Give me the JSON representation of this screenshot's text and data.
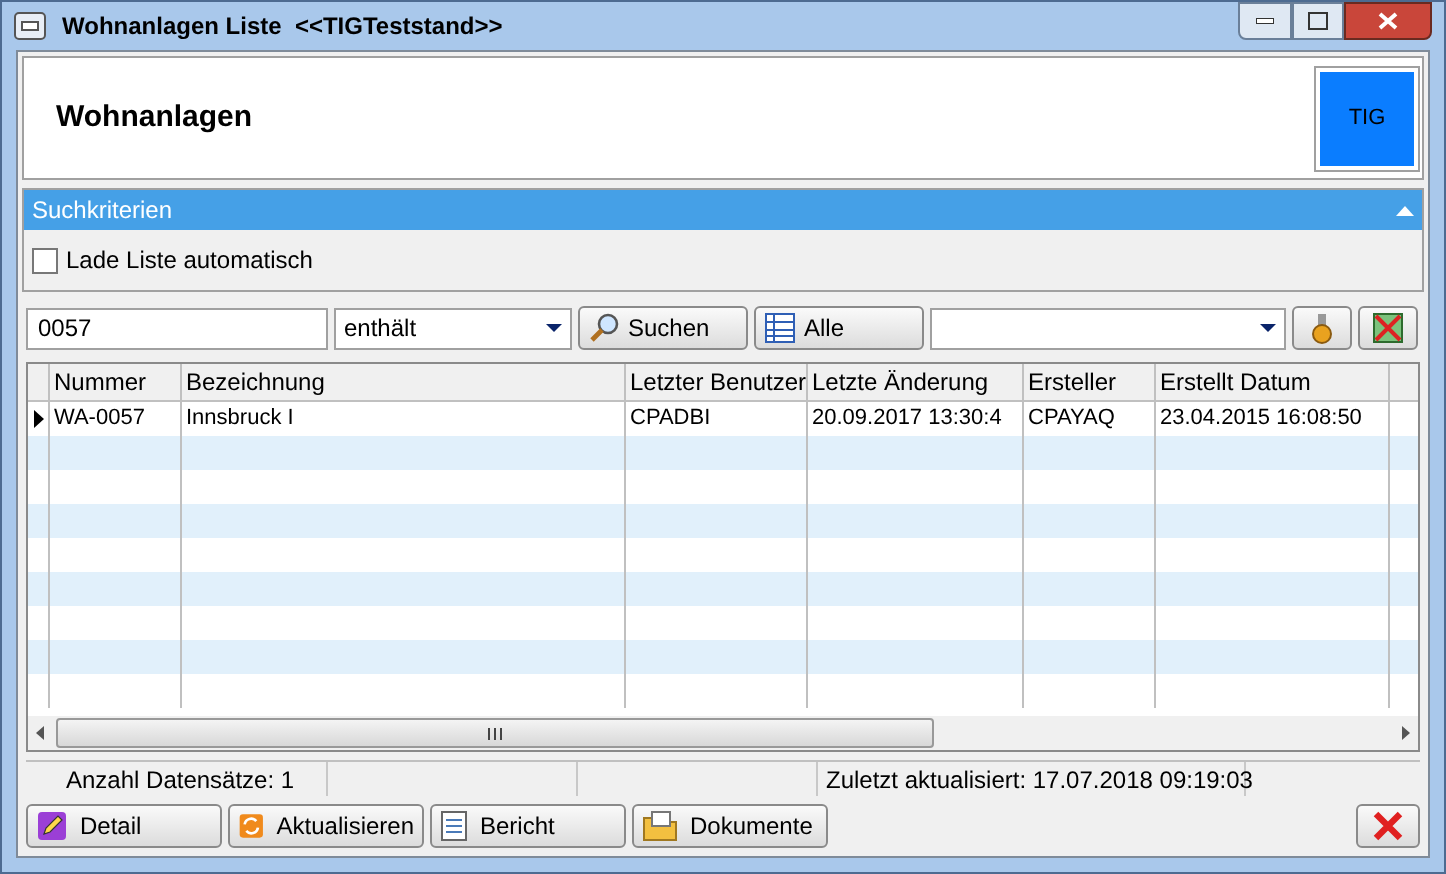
{
  "window": {
    "title": "Wohnanlagen Liste  <<TIGTeststand>>"
  },
  "header": {
    "title": "Wohnanlagen",
    "logo": "TIG"
  },
  "search_panel": {
    "title": "Suchkriterien",
    "expanded": true,
    "auto_load": {
      "label": "Lade Liste automatisch",
      "checked": false
    }
  },
  "filter": {
    "value": "0057",
    "operator": "enthält",
    "search_button": "Suchen",
    "all_button": "Alle"
  },
  "table": {
    "columns": [
      "Nummer",
      "Bezeichnung",
      "Letzter Benutzer",
      "Letzte Änderung",
      "Ersteller",
      "Erstellt Datum"
    ],
    "rows": [
      {
        "selected": true,
        "cells": [
          "WA-0057",
          "Innsbruck I",
          "CPADBI",
          "20.09.2017 13:30:4",
          "CPAYAQ",
          "23.04.2015 16:08:50"
        ]
      }
    ]
  },
  "status_bar": {
    "count": "Anzahl Datensätze: 1",
    "updated": "Zuletzt aktualisiert: 17.07.2018 09:19:03"
  },
  "buttons": [
    {
      "kind": "detail",
      "label": "Detail"
    },
    {
      "kind": "refresh",
      "label": "Aktualisieren"
    },
    {
      "kind": "report",
      "label": "Bericht"
    },
    {
      "kind": "documents",
      "label": "Dokumente"
    }
  ]
}
